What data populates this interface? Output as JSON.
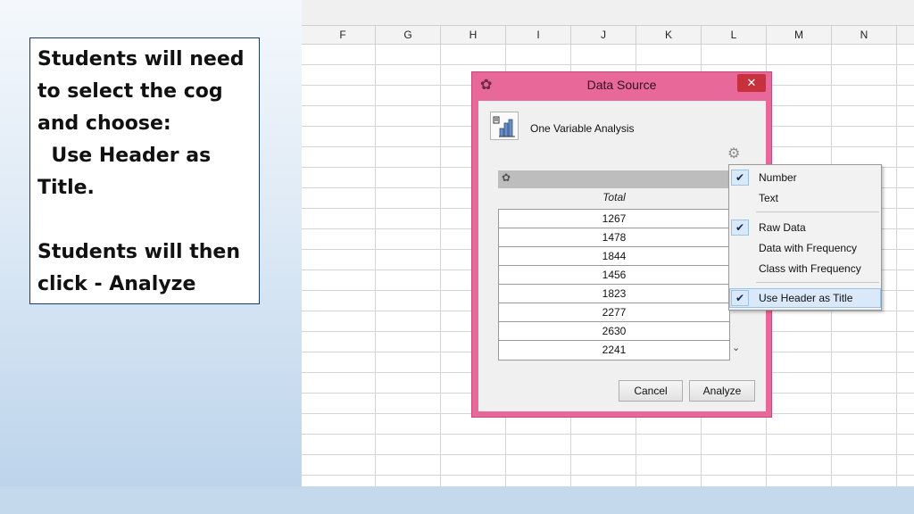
{
  "instructions": "Students will need to select the cog and choose:\n  Use Header as Title.\n\nStudents will then click - Analyze",
  "sheet": {
    "columns": [
      "F",
      "G",
      "H",
      "I",
      "J",
      "K",
      "L",
      "M",
      "N"
    ]
  },
  "dialog": {
    "title": "Data Source",
    "close_label": "✕",
    "analysis_label": "One Variable Analysis",
    "table_header": "Total",
    "rows": [
      "1267",
      "1478",
      "1844",
      "1456",
      "1823",
      "2277",
      "2630",
      "2241"
    ],
    "cancel_label": "Cancel",
    "analyze_label": "Analyze"
  },
  "menu": {
    "items": [
      {
        "label": "Number",
        "checked": true
      },
      {
        "label": "Text",
        "checked": false
      },
      {
        "label": "Raw Data",
        "checked": true
      },
      {
        "label": "Data with Frequency",
        "checked": false
      },
      {
        "label": "Class with Frequency",
        "checked": false
      },
      {
        "label": "Use Header as Title",
        "checked": true
      }
    ]
  },
  "icons": {
    "app": "geogebra-icon",
    "analysis": "bar-chart-icon",
    "cog": "cog-icon",
    "check": "checkmark-icon",
    "scroll": "chevron-down-icon"
  },
  "colors": {
    "dialog_frame": "#e8689a",
    "close_button": "#c7313d",
    "menu_highlight": "#d9e9f9"
  }
}
